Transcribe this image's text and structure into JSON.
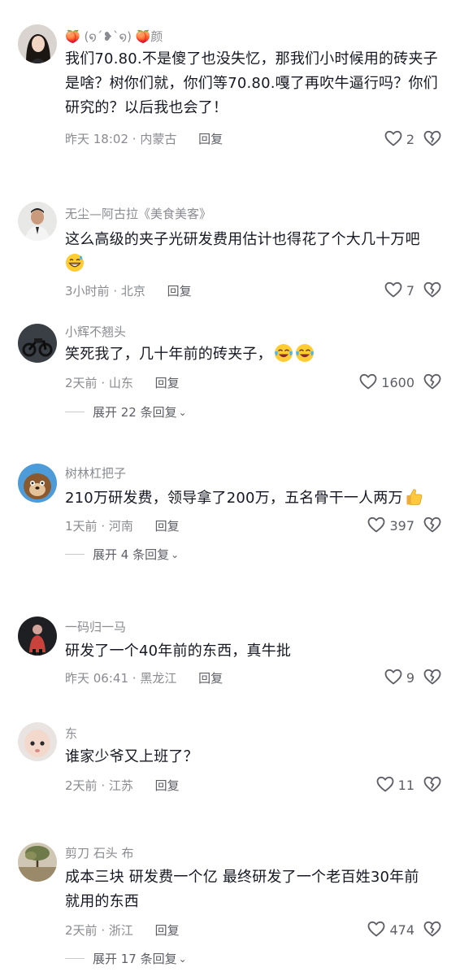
{
  "comments": [
    {
      "username": "🍑 (໑´❥`໑) 🍑颜",
      "text": "我们70.80.不是傻了也没失忆，那我们小时候用的砖夹子是啥？树你们就，你们等70.80.嘎了再吹牛逼行吗？你们研究的？以后我也会了！",
      "time": "昨天 18:02",
      "location": "内蒙古",
      "reply_label": "回复",
      "likes": "2"
    },
    {
      "username": "无尘—阿古拉《美食美客》",
      "text": "这么高级的夹子光研发费用估计也得花了个大几十万吧",
      "emoji_trailing": [
        "grinning-sweat-emoji"
      ],
      "time": "3小时前",
      "location": "北京",
      "reply_label": "回复",
      "likes": "7"
    },
    {
      "username": "小辉不翘头",
      "text": "笑死我了，几十年前的砖夹子，",
      "emoji_trailing": [
        "crying-laughing-emoji",
        "crying-laughing-emoji"
      ],
      "time": "2天前",
      "location": "山东",
      "reply_label": "回复",
      "likes": "1600",
      "expand_label": "展开 22 条回复"
    },
    {
      "username": "树林杠把子",
      "text": "210万研发费，领导拿了200万，五名骨干一人两万",
      "emoji_trailing": [
        "thumbs-up-emoji"
      ],
      "time": "1天前",
      "location": "河南",
      "reply_label": "回复",
      "likes": "397",
      "expand_label": "展开 4 条回复"
    },
    {
      "username": "一码归一马",
      "text": "研发了一个40年前的东西，真牛批",
      "time": "昨天 06:41",
      "location": "黑龙江",
      "reply_label": "回复",
      "likes": "9"
    },
    {
      "username": "东",
      "text": "谁家少爷又上班了？",
      "time": "2天前",
      "location": "江苏",
      "reply_label": "回复",
      "likes": "11"
    },
    {
      "username": "剪刀 石头 布",
      "text": "成本三块 研发费一个亿  最终研发了一个老百姓30年前就用的东西",
      "time": "2天前",
      "location": "浙江",
      "reply_label": "回复",
      "likes": "474",
      "expand_label": "展开 17 条回复"
    }
  ],
  "icons": {
    "like": "heart-outline-icon",
    "dislike": "broken-heart-outline-icon",
    "expand": "chevron-down-icon"
  },
  "colors": {
    "text_primary": "#161823",
    "text_secondary": "#8a8b91",
    "action": "#5d5e66"
  }
}
